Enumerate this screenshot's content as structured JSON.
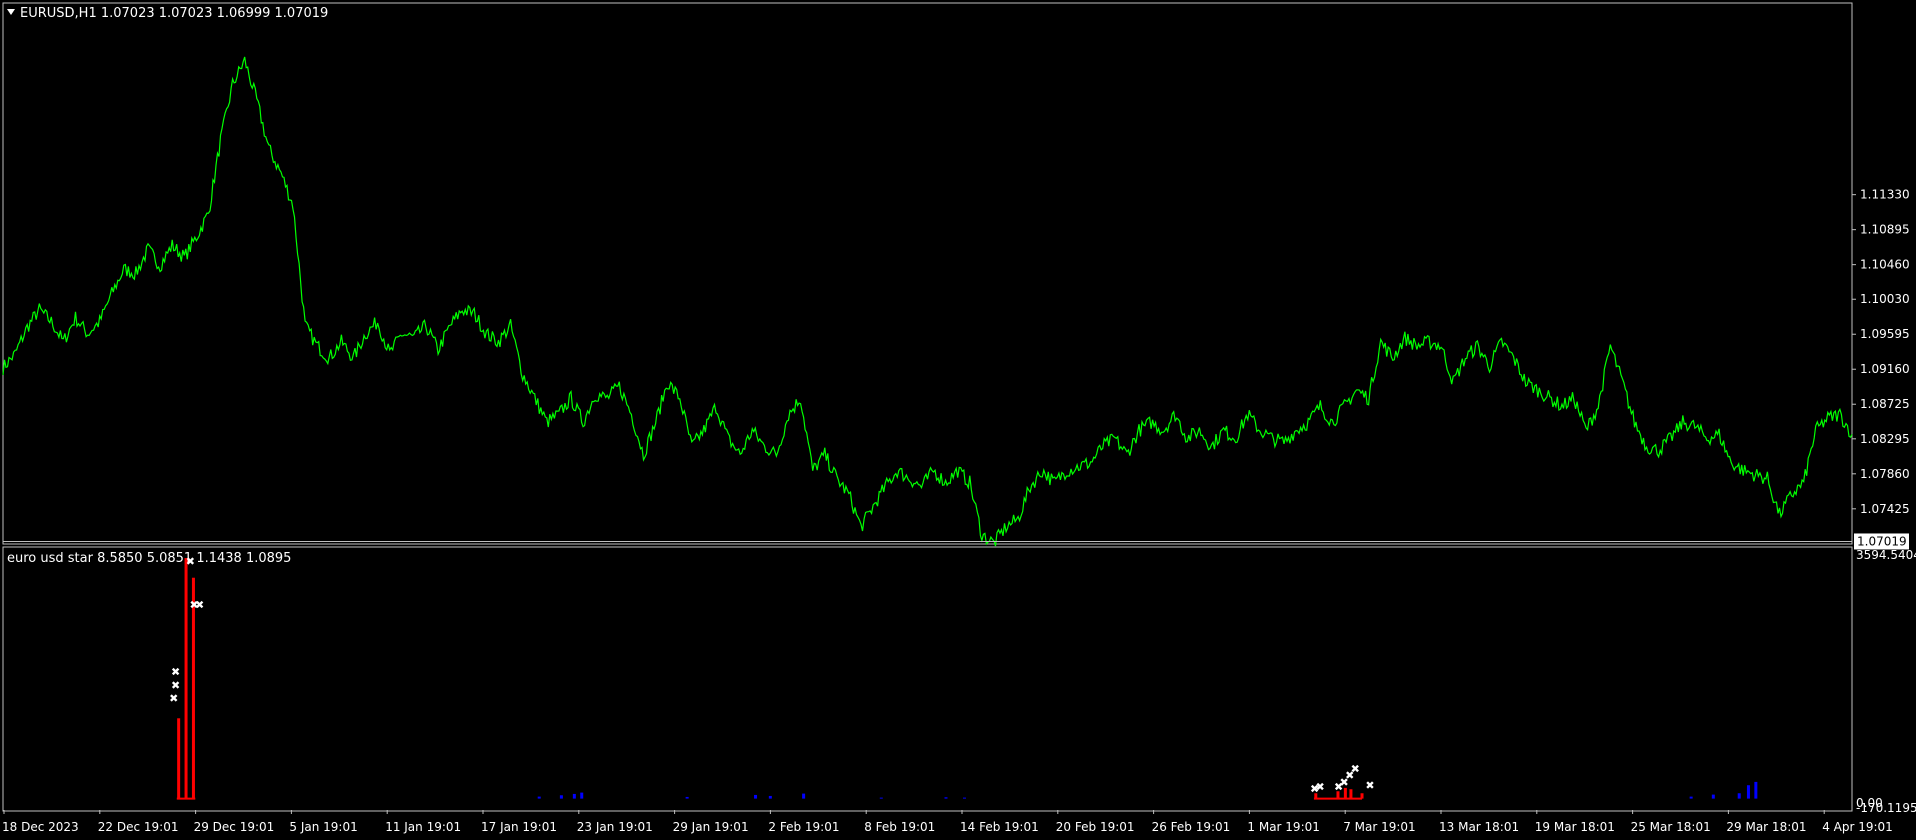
{
  "main_panel": {
    "title": "EURUSD,H1  1.07023 1.07023 1.06999 1.07019",
    "current_price_label": "1.07019",
    "colors": {
      "background": "#000000",
      "line": "#00ff00",
      "frame": "#c0c0c0"
    }
  },
  "indicator_panel": {
    "title": "euro usd star 8.5850 5.0851 1.1438 1.0895",
    "y_max_label": "3594.5404",
    "y_zero_label": "0.00",
    "y_min_label": "-170.1195",
    "colors": {
      "red_bars": "#ff0000",
      "blue_bars": "#0000ff",
      "markers": "#ffffff"
    }
  },
  "chart_data": {
    "type": "line",
    "series": [
      {
        "values": [
          1.0918,
          1.0935,
          1.0968,
          1.099,
          1.0975,
          1.095,
          1.098,
          1.096,
          1.0975,
          1.101,
          1.104,
          1.1035,
          1.1065,
          1.1045,
          1.107,
          1.1055,
          1.108,
          1.111,
          1.12,
          1.127,
          1.13,
          1.125,
          1.119,
          1.116,
          1.112,
          1.097,
          1.0945,
          1.093,
          1.095,
          1.093,
          1.096,
          1.0975,
          1.0935,
          1.096,
          1.0955,
          1.097,
          1.094,
          1.097,
          1.099,
          1.0985,
          1.096,
          1.095,
          1.097,
          1.091,
          1.088,
          1.085,
          1.086,
          1.088,
          1.085,
          1.0885,
          1.088,
          1.0895,
          1.086,
          1.081,
          1.085,
          1.09,
          1.088,
          1.082,
          1.084,
          1.087,
          1.083,
          1.081,
          1.084,
          1.082,
          1.081,
          1.086,
          1.088,
          1.079,
          1.081,
          1.078,
          1.076,
          1.072,
          1.0745,
          1.077,
          1.079,
          1.078,
          1.077,
          1.079,
          1.0775,
          1.079,
          1.0775,
          1.071,
          1.07,
          1.072,
          1.073,
          1.077,
          1.079,
          1.0775,
          1.079,
          1.0795,
          1.08,
          1.082,
          1.083,
          1.081,
          1.084,
          1.085,
          1.084,
          1.086,
          1.083,
          1.084,
          1.082,
          1.084,
          1.083,
          1.086,
          1.084,
          1.083,
          1.0825,
          1.084,
          1.085,
          1.087,
          1.085,
          1.087,
          1.089,
          1.088,
          1.095,
          1.093,
          1.0955,
          1.0945,
          1.095,
          1.0945,
          1.09,
          1.093,
          1.0945,
          1.092,
          1.095,
          1.093,
          1.09,
          1.089,
          1.088,
          1.087,
          1.088,
          1.084,
          1.087,
          1.0945,
          1.09,
          1.085,
          1.082,
          1.0815,
          1.083,
          1.085,
          1.0845,
          1.083,
          1.0835,
          1.08,
          1.079,
          1.0785,
          1.078,
          1.0735,
          1.076,
          1.0775,
          1.084,
          1.0855,
          1.086,
          1.0835
        ]
      }
    ],
    "y_ticks": [
      1.1133,
      1.10895,
      1.1046,
      1.1003,
      1.09595,
      1.0916,
      1.08725,
      1.08295,
      1.0786,
      1.07425
    ],
    "y_tick_labels": [
      "1.11330",
      "1.10895",
      "1.10460",
      "1.10030",
      "1.09595",
      "1.09160",
      "1.08725",
      "1.08295",
      "1.07860",
      "1.07425"
    ],
    "x_tick_labels": [
      "18 Dec 2023",
      "22 Dec 19:01",
      "29 Dec 19:01",
      "5 Jan 19:01",
      "11 Jan 19:01",
      "17 Jan 19:01",
      "23 Jan 19:01",
      "29 Jan 19:01",
      "2 Feb 19:01",
      "8 Feb 19:01",
      "14 Feb 19:01",
      "20 Feb 19:01",
      "26 Feb 19:01",
      "1 Mar 19:01",
      "7 Mar 19:01",
      "13 Mar 18:01",
      "19 Mar 18:01",
      "25 Mar 18:01",
      "29 Mar 18:01",
      "4 Apr 19:01"
    ],
    "current_price": 1.07019,
    "ylim": [
      1.07,
      1.137
    ],
    "grid": false,
    "indicator": {
      "ylim": [
        -170.1195,
        3594.5404
      ],
      "red_bars": [
        {
          "t": 0.095,
          "v": 1200
        },
        {
          "t": 0.099,
          "v": 3594.5
        },
        {
          "t": 0.103,
          "v": 3300
        },
        {
          "t": 0.71,
          "v": 80
        },
        {
          "t": 0.722,
          "v": 110
        },
        {
          "t": 0.726,
          "v": 160
        },
        {
          "t": 0.729,
          "v": 140
        },
        {
          "t": 0.735,
          "v": 80
        }
      ],
      "blue_bars": [
        {
          "t": 0.29,
          "v": 30
        },
        {
          "t": 0.302,
          "v": 50
        },
        {
          "t": 0.309,
          "v": 70
        },
        {
          "t": 0.313,
          "v": 90
        },
        {
          "t": 0.37,
          "v": 25
        },
        {
          "t": 0.407,
          "v": 55
        },
        {
          "t": 0.415,
          "v": 40
        },
        {
          "t": 0.433,
          "v": 75
        },
        {
          "t": 0.475,
          "v": 15
        },
        {
          "t": 0.51,
          "v": 20
        },
        {
          "t": 0.52,
          "v": 15
        },
        {
          "t": 0.913,
          "v": 30
        },
        {
          "t": 0.925,
          "v": 60
        },
        {
          "t": 0.939,
          "v": 80
        },
        {
          "t": 0.944,
          "v": 200
        },
        {
          "t": 0.948,
          "v": 250
        }
      ],
      "markers": [
        {
          "t": 0.093,
          "v": 1900
        },
        {
          "t": 0.093,
          "v": 1700
        },
        {
          "t": 0.092,
          "v": 1500
        },
        {
          "t": 0.101,
          "v": 3550
        },
        {
          "t": 0.103,
          "v": 2900
        },
        {
          "t": 0.106,
          "v": 2900
        },
        {
          "t": 0.709,
          "v": 150
        },
        {
          "t": 0.712,
          "v": 180
        },
        {
          "t": 0.722,
          "v": 180
        },
        {
          "t": 0.725,
          "v": 250
        },
        {
          "t": 0.728,
          "v": 350
        },
        {
          "t": 0.731,
          "v": 450
        },
        {
          "t": 0.739,
          "v": 200
        }
      ]
    }
  }
}
